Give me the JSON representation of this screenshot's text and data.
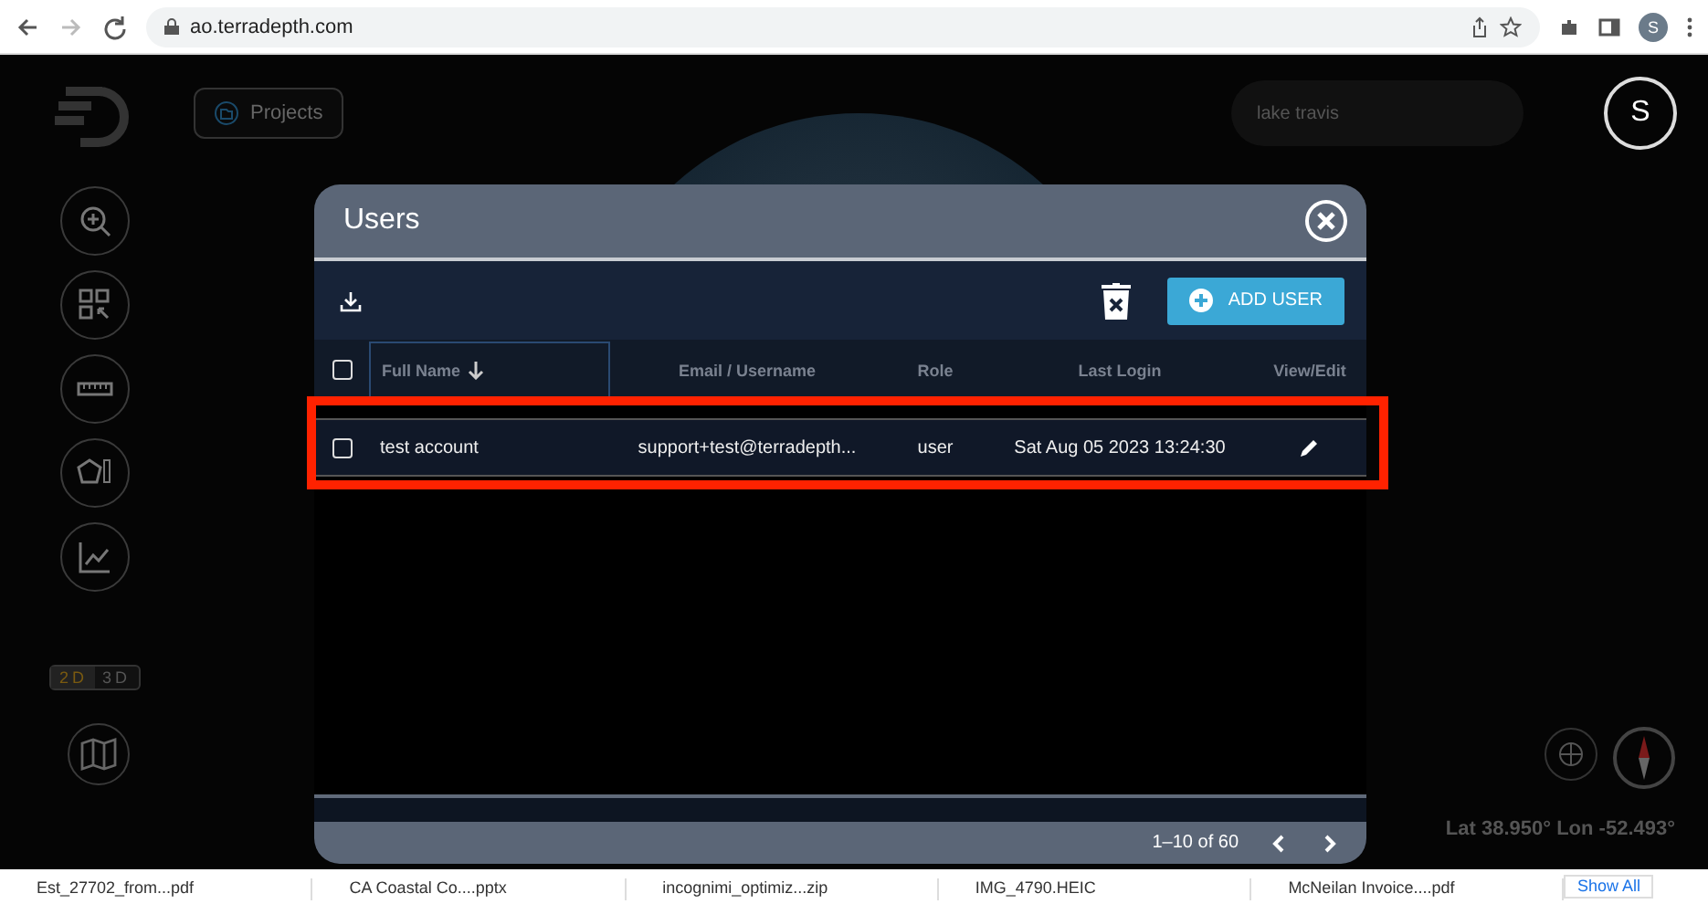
{
  "browser": {
    "url": "ao.terradepth.com",
    "profile": "S"
  },
  "header": {
    "projects_button": "Projects",
    "search": {
      "value": "lake travis"
    },
    "avatar": "S"
  },
  "tools": [
    {
      "kind": "zoom"
    },
    {
      "kind": "select"
    },
    {
      "kind": "ruler"
    },
    {
      "kind": "polygon"
    },
    {
      "kind": "chart"
    }
  ],
  "view_toggle": [
    {
      "label": "2D",
      "selected": true
    },
    {
      "label": "3D",
      "selected": false
    }
  ],
  "dialog": {
    "title": "Users",
    "add_user_button": "ADD USER",
    "all_checked": false,
    "columns": [
      {
        "label": "Full Name",
        "sorted": true
      },
      {
        "label": "Email / Username",
        "sorted": false
      },
      {
        "label": "Role",
        "sorted": false
      },
      {
        "label": "Last Login",
        "sorted": false
      },
      {
        "label": "View/Edit",
        "sorted": false
      }
    ],
    "rows": [
      {
        "selected": false,
        "highlighted": true,
        "full_name": "test account",
        "email": "support+test@terradepth...",
        "role": "user",
        "last_login": "Sat Aug 05 2023 13:24:30"
      }
    ],
    "pagination": "1–10 of 60"
  },
  "coordinates": "Lat 38.950° Lon -52.493°",
  "downloads": [
    {
      "name": "Est_27702_from...pdf"
    },
    {
      "name": "CA Coastal Co....pptx"
    },
    {
      "name": "incognimi_optimiz...zip"
    },
    {
      "name": "IMG_4790.HEIC"
    },
    {
      "name": "McNeilan Invoice....pdf"
    }
  ],
  "show_all": "Show All"
}
